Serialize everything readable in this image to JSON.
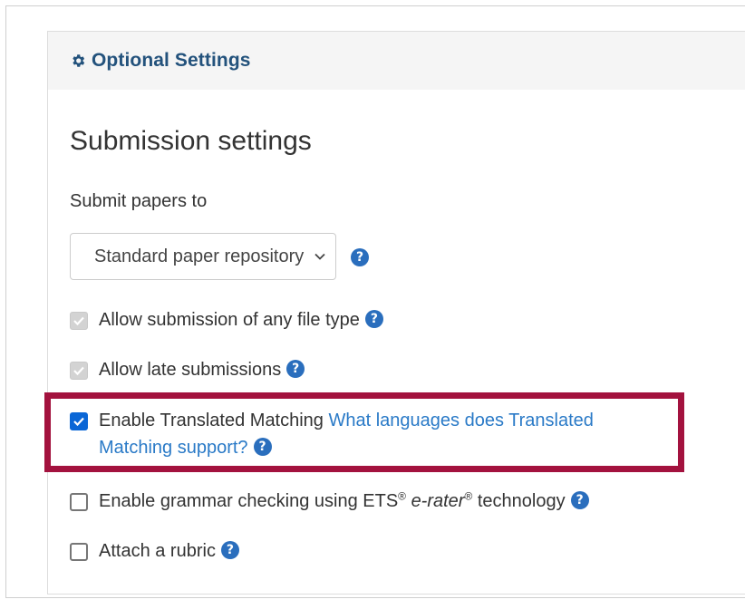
{
  "panel": {
    "title": "Optional Settings",
    "icon": "gear-icon"
  },
  "section": {
    "heading": "Submission settings"
  },
  "submit_papers": {
    "label": "Submit papers to",
    "selected_value": "Standard paper repository"
  },
  "options": [
    {
      "label": "Allow submission of any file type",
      "checked": true,
      "disabled": true
    },
    {
      "label": "Allow late submissions",
      "checked": true,
      "disabled": true
    },
    {
      "label": "Enable Translated Matching",
      "link_text": "What languages does Translated Matching support?",
      "checked": true,
      "disabled": false
    },
    {
      "label_prefix": "Enable grammar checking using ETS",
      "reg1": "®",
      "label_italic": "e-rater",
      "reg2": "®",
      "label_suffix": "technology",
      "checked": false,
      "disabled": false
    },
    {
      "label": "Attach a rubric",
      "checked": false,
      "disabled": false
    }
  ],
  "colors": {
    "accent": "#23527c",
    "help_icon": "#2a6ebd",
    "link": "#2a7ac7",
    "checkbox_checked": "#0a66d6",
    "highlight_border": "#a3123e"
  }
}
